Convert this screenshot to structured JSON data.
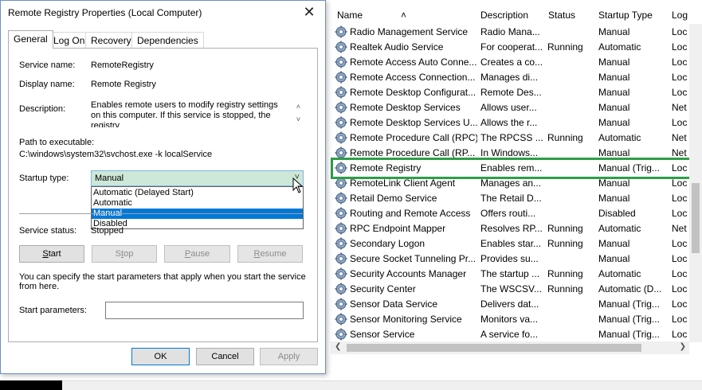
{
  "services": {
    "columns": {
      "name": "Name",
      "description": "Description",
      "status": "Status",
      "startup_type": "Startup Type",
      "log_on_as": "Log"
    },
    "rows": [
      {
        "name": "Radio Management Service",
        "description": "Radio Mana...",
        "status": "",
        "startup_type": "Manual",
        "log_on_as": "Loc"
      },
      {
        "name": "Realtek Audio Service",
        "description": "For cooperat...",
        "status": "Running",
        "startup_type": "Automatic",
        "log_on_as": "Loc"
      },
      {
        "name": "Remote Access Auto Conne...",
        "description": "Creates a co...",
        "status": "",
        "startup_type": "Manual",
        "log_on_as": "Loc"
      },
      {
        "name": "Remote Access Connection...",
        "description": "Manages di...",
        "status": "",
        "startup_type": "Manual",
        "log_on_as": "Loc"
      },
      {
        "name": "Remote Desktop Configurat...",
        "description": "Remote Des...",
        "status": "",
        "startup_type": "Manual",
        "log_on_as": "Loc"
      },
      {
        "name": "Remote Desktop Services",
        "description": "Allows user...",
        "status": "",
        "startup_type": "Manual",
        "log_on_as": "Net"
      },
      {
        "name": "Remote Desktop Services U...",
        "description": "Allows the r...",
        "status": "",
        "startup_type": "Manual",
        "log_on_as": "Loc"
      },
      {
        "name": "Remote Procedure Call (RPC)",
        "description": "The RPCSS ...",
        "status": "Running",
        "startup_type": "Automatic",
        "log_on_as": "Net"
      },
      {
        "name": "Remote Procedure Call (RP...",
        "description": "In Windows...",
        "status": "",
        "startup_type": "Manual",
        "log_on_as": "Net"
      },
      {
        "name": "Remote Registry",
        "description": "Enables rem...",
        "status": "",
        "startup_type": "Manual (Trig...",
        "log_on_as": "Loc"
      },
      {
        "name": "RemoteLink Client Agent",
        "description": "Manages an...",
        "status": "",
        "startup_type": "Manual",
        "log_on_as": "Loc"
      },
      {
        "name": "Retail Demo Service",
        "description": "The Retail D...",
        "status": "",
        "startup_type": "Manual",
        "log_on_as": "Loc"
      },
      {
        "name": "Routing and Remote Access",
        "description": "Offers routi...",
        "status": "",
        "startup_type": "Disabled",
        "log_on_as": "Loc"
      },
      {
        "name": "RPC Endpoint Mapper",
        "description": "Resolves RP...",
        "status": "Running",
        "startup_type": "Automatic",
        "log_on_as": "Net"
      },
      {
        "name": "Secondary Logon",
        "description": "Enables star...",
        "status": "Running",
        "startup_type": "Manual",
        "log_on_as": "Loc"
      },
      {
        "name": "Secure Socket Tunneling Pr...",
        "description": "Provides su...",
        "status": "",
        "startup_type": "Manual",
        "log_on_as": "Loc"
      },
      {
        "name": "Security Accounts Manager",
        "description": "The startup ...",
        "status": "Running",
        "startup_type": "Automatic",
        "log_on_as": "Loc"
      },
      {
        "name": "Security Center",
        "description": "The WSCSV...",
        "status": "Running",
        "startup_type": "Automatic (D...",
        "log_on_as": "Loc"
      },
      {
        "name": "Sensor Data Service",
        "description": "Delivers dat...",
        "status": "",
        "startup_type": "Manual (Trig...",
        "log_on_as": "Loc"
      },
      {
        "name": "Sensor Monitoring Service",
        "description": "Monitors va...",
        "status": "",
        "startup_type": "Manual (Trig...",
        "log_on_as": "Loc"
      },
      {
        "name": "Sensor Service",
        "description": "A service fo...",
        "status": "",
        "startup_type": "Manual (Trig...",
        "log_on_as": "Loc"
      }
    ],
    "highlight_color": "#2e9e48"
  },
  "dialog": {
    "title": "Remote Registry Properties (Local Computer)",
    "tabs": [
      "General",
      "Log On",
      "Recovery",
      "Dependencies"
    ],
    "service_name_label": "Service name:",
    "service_name": "RemoteRegistry",
    "display_name_label": "Display name:",
    "display_name": "Remote Registry",
    "description_label": "Description:",
    "description": "Enables remote users to modify registry settings on this computer. If this service is stopped, the registry",
    "path_label": "Path to executable:",
    "path": "C:\\windows\\system32\\svchost.exe -k localService",
    "startup_type_label": "Startup type:",
    "startup_type_value": "Manual",
    "startup_options": [
      "Automatic (Delayed Start)",
      "Automatic",
      "Manual",
      "Disabled"
    ],
    "startup_selected_index": 2,
    "service_status_label": "Service status:",
    "service_status": "Stopped",
    "buttons": {
      "start": "Start",
      "stop": "Stop",
      "pause": "Pause",
      "resume": "Resume"
    },
    "start_params_help": "You can specify the start parameters that apply when you start the service from here.",
    "start_params_label": "Start parameters:",
    "start_params_value": "",
    "ok": "OK",
    "cancel": "Cancel",
    "apply": "Apply",
    "accent_color": "#0078d7"
  }
}
